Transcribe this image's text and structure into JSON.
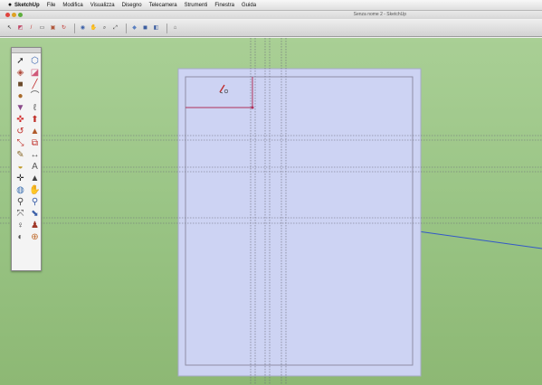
{
  "menubar": {
    "apple_icon": "",
    "items": [
      "SketchUp",
      "File",
      "Modifica",
      "Visualizza",
      "Disegno",
      "Telecamera",
      "Strumenti",
      "Finestra",
      "Guida"
    ]
  },
  "window": {
    "title": "Senza nome 2 - SketchUp"
  },
  "toolbar": {
    "tools": [
      {
        "name": "select-tool-icon",
        "glyph": "↖",
        "color": "#2b2b2b"
      },
      {
        "name": "eraser-tool-icon",
        "glyph": "◩",
        "color": "#c04868"
      },
      {
        "name": "pencil-tool-icon",
        "glyph": "/",
        "color": "#c0302a"
      },
      {
        "name": "rectangle-tool-icon",
        "glyph": "▭",
        "color": "#444444"
      },
      {
        "name": "push-pull-tool-icon",
        "glyph": "▣",
        "color": "#b0563a"
      },
      {
        "name": "rotate-tool-icon",
        "glyph": "↻",
        "color": "#c0302a"
      },
      {
        "name": "separator"
      },
      {
        "name": "orbit-tool-icon",
        "glyph": "◉",
        "color": "#3a5fa8"
      },
      {
        "name": "pan-tool-icon",
        "glyph": "✋",
        "color": "#a07a44"
      },
      {
        "name": "zoom-tool-icon",
        "glyph": "⌕",
        "color": "#444444"
      },
      {
        "name": "zoom-extents-icon",
        "glyph": "⤢",
        "color": "#444444"
      },
      {
        "name": "separator"
      },
      {
        "name": "iso-view-icon",
        "glyph": "◆",
        "color": "#5a7fc0"
      },
      {
        "name": "top-view-icon",
        "glyph": "◼",
        "color": "#3c5ea0"
      },
      {
        "name": "front-view-icon",
        "glyph": "◧",
        "color": "#3c5ea0"
      },
      {
        "name": "separator"
      },
      {
        "name": "warehouse-icon",
        "glyph": "⌂",
        "color": "#555555"
      }
    ]
  },
  "palette": {
    "tools": [
      {
        "name": "select-icon",
        "glyph": "➚",
        "color": "#222222"
      },
      {
        "name": "make-component-icon",
        "glyph": "⬡",
        "color": "#3b66b0"
      },
      {
        "name": "paint-bucket-icon",
        "glyph": "◈",
        "color": "#b04a3a"
      },
      {
        "name": "eraser-icon",
        "glyph": "◪",
        "color": "#d05a7a"
      },
      {
        "name": "rectangle-icon",
        "glyph": "■",
        "color": "#6b4a2a"
      },
      {
        "name": "line-icon",
        "glyph": "╱",
        "color": "#c02a2a"
      },
      {
        "name": "circle-icon",
        "glyph": "●",
        "color": "#a86a2a"
      },
      {
        "name": "arc-icon",
        "glyph": "⌒",
        "color": "#555555"
      },
      {
        "name": "polygon-icon",
        "glyph": "▼",
        "color": "#8a4a8a"
      },
      {
        "name": "freehand-icon",
        "glyph": "ℓ",
        "color": "#555555"
      },
      {
        "name": "move-icon",
        "glyph": "✜",
        "color": "#d02a2a"
      },
      {
        "name": "push-pull-icon",
        "glyph": "⬆",
        "color": "#c0302a"
      },
      {
        "name": "rotate-icon",
        "glyph": "↺",
        "color": "#c0302a"
      },
      {
        "name": "follow-me-icon",
        "glyph": "▲",
        "color": "#b05a2a"
      },
      {
        "name": "scale-icon",
        "glyph": "⤡",
        "color": "#c0302a"
      },
      {
        "name": "offset-icon",
        "glyph": "⧉",
        "color": "#c0302a"
      },
      {
        "name": "tape-measure-icon",
        "glyph": "✎",
        "color": "#8a6a2a"
      },
      {
        "name": "dimension-icon",
        "glyph": "↔",
        "color": "#555555"
      },
      {
        "name": "protractor-icon",
        "glyph": "◒",
        "color": "#c09a2a"
      },
      {
        "name": "text-icon",
        "glyph": "A",
        "color": "#555555"
      },
      {
        "name": "axes-icon",
        "glyph": "✛",
        "color": "#2a2a2a"
      },
      {
        "name": "3d-text-icon",
        "glyph": "▲",
        "color": "#444444"
      },
      {
        "name": "orbit-icon",
        "glyph": "◍",
        "color": "#3a6fb0"
      },
      {
        "name": "pan-icon",
        "glyph": "✋",
        "color": "#a07a44"
      },
      {
        "name": "zoom-icon",
        "glyph": "⚲",
        "color": "#444444"
      },
      {
        "name": "zoom-window-icon",
        "glyph": "⚲",
        "color": "#3a5fa8"
      },
      {
        "name": "zoom-extents-icon",
        "glyph": "⤧",
        "color": "#444444"
      },
      {
        "name": "previous-view-icon",
        "glyph": "⬊",
        "color": "#3a5fa8"
      },
      {
        "name": "position-camera-icon",
        "glyph": "♀",
        "color": "#444444"
      },
      {
        "name": "walk-icon",
        "glyph": "♟",
        "color": "#a03a2a"
      },
      {
        "name": "look-around-icon",
        "glyph": "◐",
        "color": "#555555"
      },
      {
        "name": "section-plane-icon",
        "glyph": "⊕",
        "color": "#c06a2a"
      }
    ]
  },
  "colors": {
    "sky_green": "#a9cf95",
    "sheet_fill": "#cdd3f3",
    "sheet_border": "#8e8ea6",
    "guide_line": "#6a6a78",
    "edge_red": "#b0305a",
    "axis_blue": "#3358c8"
  }
}
